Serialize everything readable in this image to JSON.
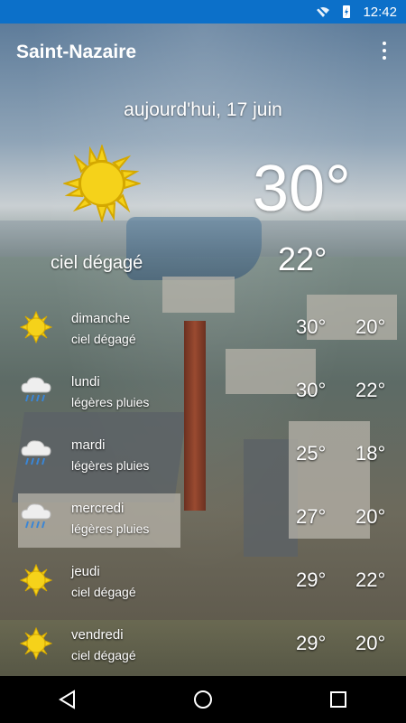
{
  "status_bar": {
    "time": "12:42",
    "wifi_icon": "wifi-icon",
    "battery_icon": "battery-charging-icon"
  },
  "header": {
    "city": "Saint-Nazaire",
    "menu_icon": "more-vert-icon"
  },
  "today": {
    "date": "aujourd'hui, 17 juin",
    "condition": "ciel dégagé",
    "max_temp": "30°",
    "min_temp": "22°",
    "icon": "sun-icon"
  },
  "forecast": [
    {
      "day": "dimanche",
      "condition": "ciel dégagé",
      "hi": "30°",
      "lo": "20°",
      "icon": "sun-icon"
    },
    {
      "day": "lundi",
      "condition": "légères pluies",
      "hi": "30°",
      "lo": "22°",
      "icon": "rain-cloud-icon"
    },
    {
      "day": "mardi",
      "condition": "légères pluies",
      "hi": "25°",
      "lo": "18°",
      "icon": "rain-cloud-icon"
    },
    {
      "day": "mercredi",
      "condition": "légères pluies",
      "hi": "27°",
      "lo": "20°",
      "icon": "rain-cloud-icon"
    },
    {
      "day": "jeudi",
      "condition": "ciel dégagé",
      "hi": "29°",
      "lo": "22°",
      "icon": "sun-icon"
    },
    {
      "day": "vendredi",
      "condition": "ciel dégagé",
      "hi": "29°",
      "lo": "20°",
      "icon": "sun-icon"
    }
  ],
  "nav": {
    "back_icon": "back-icon",
    "home_icon": "home-icon",
    "recents_icon": "recents-icon"
  },
  "colors": {
    "status_bar": "#0c70c9",
    "sun": "#f5d21a",
    "sun_stroke": "#d4a800"
  }
}
